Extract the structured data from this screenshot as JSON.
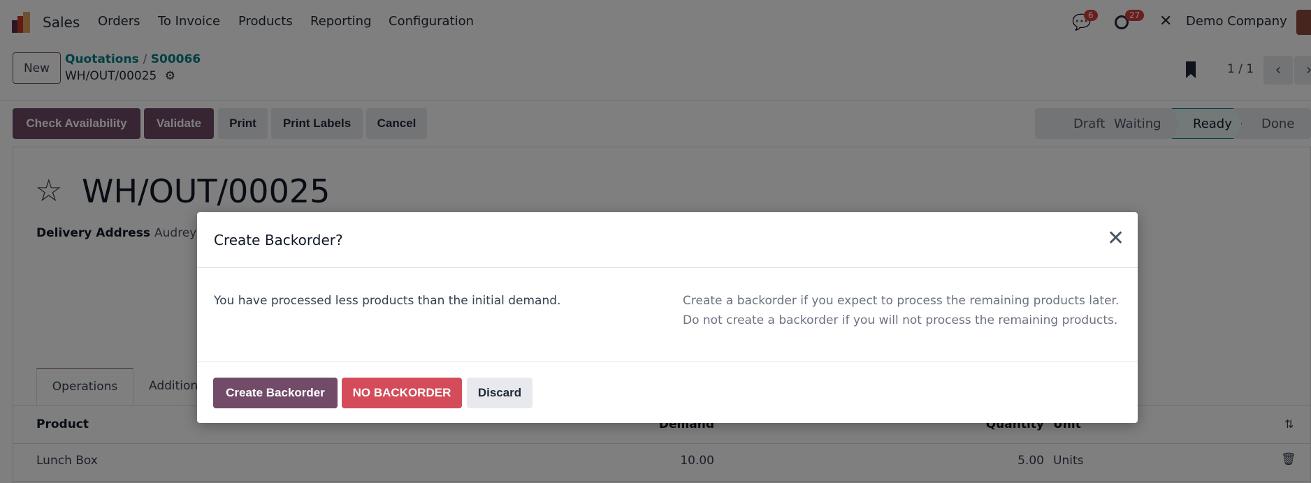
{
  "navbar": {
    "app_name": "Sales",
    "menu": [
      "Orders",
      "To Invoice",
      "Products",
      "Reporting",
      "Configuration"
    ],
    "messages_count": "6",
    "activities_count": "27",
    "company": "Demo Company"
  },
  "control": {
    "new_label": "New",
    "breadcrumb": [
      "Quotations",
      "S00066"
    ],
    "record_name": "WH/OUT/00025",
    "pager": "1 / 1"
  },
  "actions": [
    "Check Availability",
    "Validate",
    "Print",
    "Print Labels",
    "Cancel"
  ],
  "statusbar": {
    "stages": [
      "Draft",
      "Waiting",
      "Ready",
      "Done"
    ],
    "current": "Ready"
  },
  "form": {
    "title": "WH/OUT/00025",
    "delivery_label": "Delivery Address",
    "delivery_value": "Audrey",
    "tabs": [
      "Operations",
      "Addition"
    ],
    "columns": {
      "product": "Product",
      "demand": "Demand",
      "quantity": "Quantity",
      "unit": "Unit"
    },
    "rows": [
      {
        "product": "Lunch Box",
        "demand": "10.00",
        "quantity": "5.00",
        "unit": "Units"
      }
    ]
  },
  "modal": {
    "title": "Create Backorder?",
    "left_text": "You have processed less products than the initial demand.",
    "right_line1": "Create a backorder if you expect to process the remaining products later.",
    "right_line2": "Do not create a backorder if you will not process the remaining products.",
    "buttons": [
      "Create Backorder",
      "NO BACKORDER",
      "Discard"
    ]
  },
  "colors": {
    "primary": "#714b67",
    "danger": "#d44c59",
    "link": "#017e84"
  }
}
